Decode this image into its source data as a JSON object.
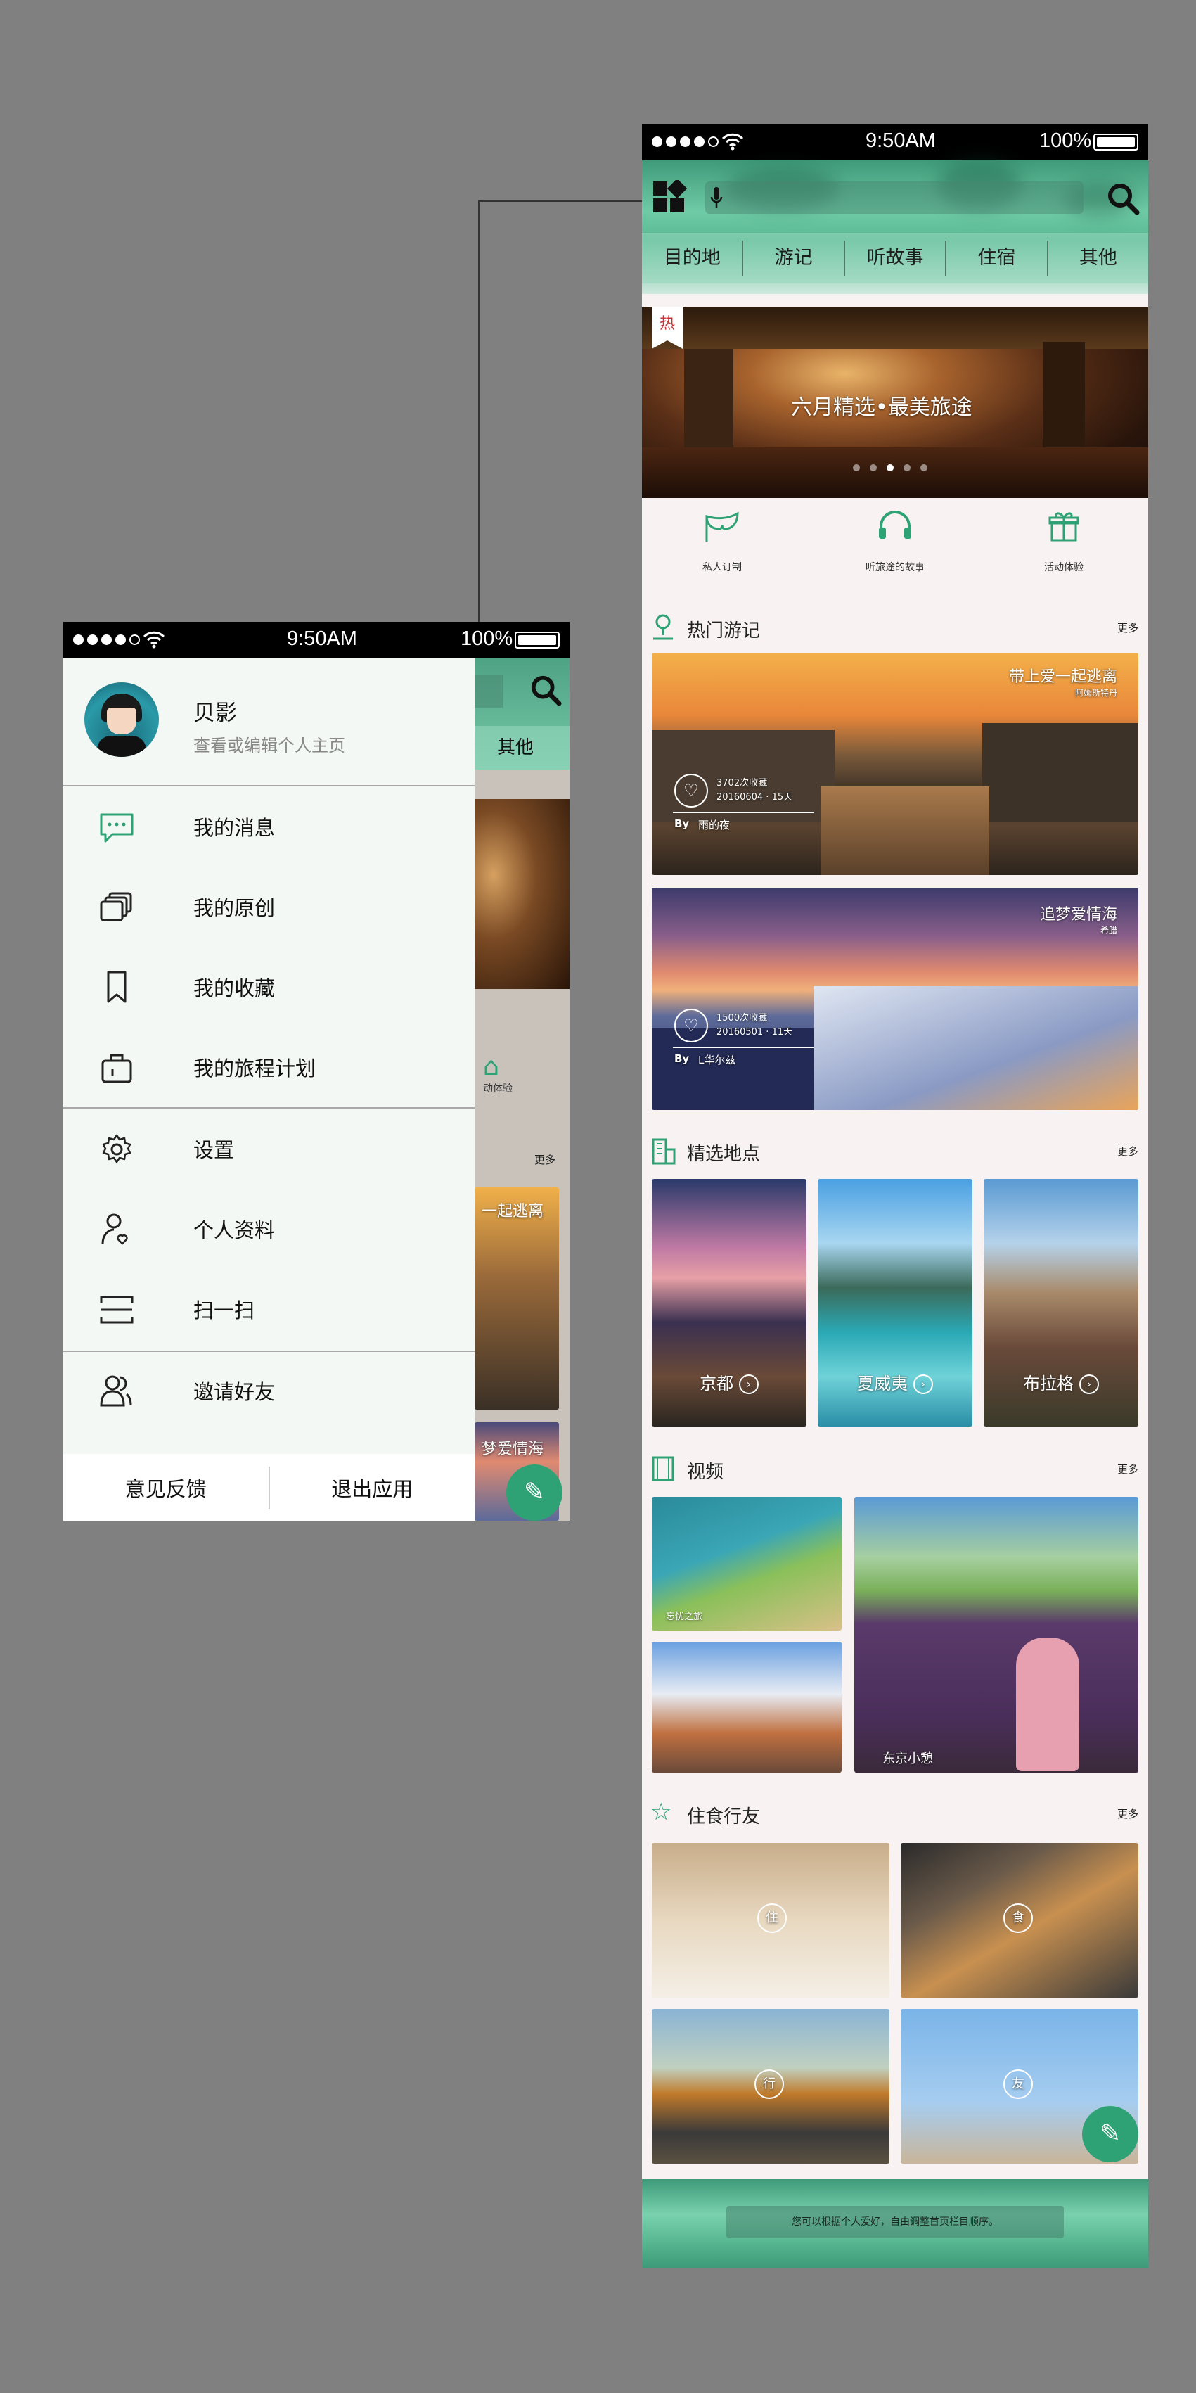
{
  "main_phone": {
    "status": {
      "time": "9:50AM",
      "battery": "100%"
    },
    "tabs": [
      "目的地",
      "游记",
      "听故事",
      "住宿",
      "其他"
    ],
    "banner": {
      "hot_tag": "热",
      "title": "六月精选•最美旅途"
    },
    "categories": [
      {
        "label": "私人订制",
        "icon": "mask-icon"
      },
      {
        "label": "听旅途的故事",
        "icon": "headphones-icon"
      },
      {
        "label": "活动体验",
        "icon": "gift-icon"
      }
    ],
    "hot_travel": {
      "title": "热门游记",
      "more": "更多",
      "cards": [
        {
          "title": "带上爱一起逃离",
          "location": "阿姆斯特丹",
          "stats": "3702次收藏",
          "date": "20160604 · 15天",
          "by": "By",
          "author": "雨的夜"
        },
        {
          "title": "追梦爱情海",
          "location": "希腊",
          "stats": "1500次收藏",
          "date": "20160501 · 11天",
          "by": "By",
          "author": "L华尔兹"
        }
      ]
    },
    "places": {
      "title": "精选地点",
      "more": "更多",
      "items": [
        "京都",
        "夏威夷",
        "布拉格"
      ]
    },
    "video": {
      "title": "视频",
      "more": "更多",
      "items": [
        "忘忧之旅",
        "",
        "东京小憩"
      ]
    },
    "life": {
      "title": "住食行友",
      "more": "更多",
      "items": [
        "住",
        "食",
        "行",
        "友"
      ]
    },
    "footer_hint": "您可以根据个人爱好，自由调整首页栏目顺序。"
  },
  "drawer_phone": {
    "status": {
      "time": "9:50AM",
      "battery": "100%"
    },
    "peek_tab": "其他",
    "peek_more": "更多",
    "peek_cat": "动体验",
    "peek_card1": "一起逃离",
    "peek_card2": "梦爱情海",
    "profile": {
      "name": "贝影",
      "subtitle": "查看或编辑个人主页"
    },
    "menu": [
      {
        "label": "我的消息",
        "icon": "message-icon"
      },
      {
        "label": "我的原创",
        "icon": "layers-icon"
      },
      {
        "label": "我的收藏",
        "icon": "bookmark-icon"
      },
      {
        "label": "我的旅程计划",
        "icon": "bag-icon"
      },
      {
        "label": "设置",
        "icon": "gear-icon"
      },
      {
        "label": "个人资料",
        "icon": "person-icon"
      },
      {
        "label": "扫一扫",
        "icon": "scan-icon"
      },
      {
        "label": "邀请好友",
        "icon": "friends-icon"
      }
    ],
    "footer": {
      "feedback": "意见反馈",
      "logout": "退出应用"
    }
  },
  "colors": {
    "accent": "#2fa275",
    "header": "#5fbe98",
    "background": "#808080"
  }
}
